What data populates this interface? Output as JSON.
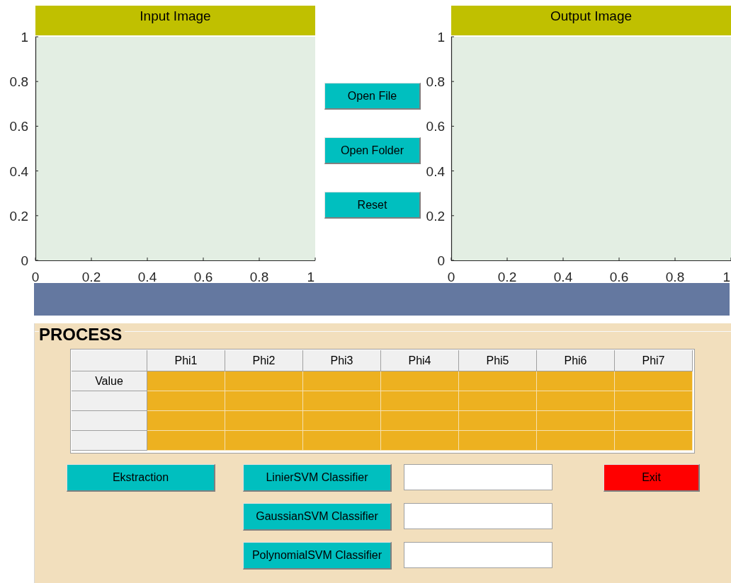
{
  "plots": [
    {
      "title": "Input Image",
      "yticks": [
        "1",
        "0.8",
        "0.6",
        "0.4",
        "0.2",
        "0"
      ],
      "xticks": [
        "0",
        "0.2",
        "0.4",
        "0.6",
        "0.8",
        "1"
      ]
    },
    {
      "title": "Output Image",
      "yticks": [
        "1",
        "0.8",
        "0.6",
        "0.4",
        "0.2",
        "0"
      ],
      "xticks": [
        "0",
        "0.2",
        "0.4",
        "0.6",
        "0.8",
        "1"
      ]
    }
  ],
  "file_buttons": [
    "Open File",
    "Open Folder",
    "Reset"
  ],
  "process": {
    "title": "PROCESS",
    "table": {
      "columns": [
        "Phi1",
        "Phi2",
        "Phi3",
        "Phi4",
        "Phi5",
        "Phi6",
        "Phi7"
      ],
      "rows": [
        {
          "header": "Value"
        },
        {},
        {},
        {}
      ]
    },
    "extract_button": "Ekstraction",
    "classifiers": [
      {
        "button": "LinierSVM Classifier"
      },
      {
        "button": "GaussianSVM Classifier"
      },
      {
        "button": "PolynomialSVM Classifier"
      }
    ],
    "exit_button": "Exit"
  }
}
